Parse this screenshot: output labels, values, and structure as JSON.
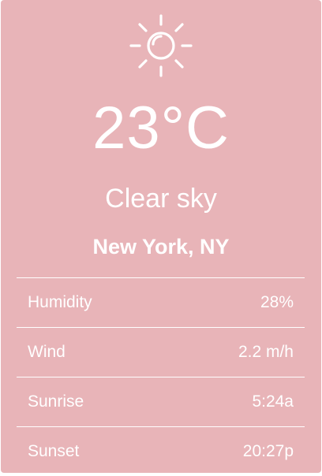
{
  "weather": {
    "icon": "sun-icon",
    "temperature": "23°C",
    "condition": "Clear sky",
    "location": "New York, NY",
    "details": [
      {
        "label": "Humidity",
        "value": "28%"
      },
      {
        "label": "Wind",
        "value": "2.2 m/h"
      },
      {
        "label": "Sunrise",
        "value": "5:24a"
      },
      {
        "label": "Sunset",
        "value": "20:27p"
      }
    ]
  },
  "colors": {
    "card_background": "#e8b4b8",
    "text": "#ffffff"
  }
}
